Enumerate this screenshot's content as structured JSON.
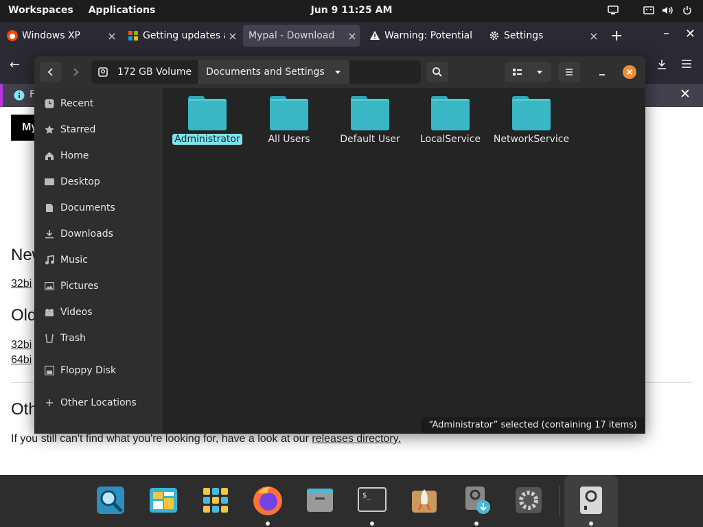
{
  "topbar": {
    "workspaces": "Workspaces",
    "applications": "Applications",
    "clock": "Jun 9  11:25 AM"
  },
  "browser": {
    "tabs": [
      {
        "title": "Windows XP",
        "favicon": "reddit-icon"
      },
      {
        "title": "Getting updates an",
        "favicon": "windows-flag-icon"
      },
      {
        "title": "Mypal - Download",
        "favicon": "none"
      },
      {
        "title": "Warning: Potential",
        "favicon": "warning-icon"
      },
      {
        "title": "Settings",
        "favicon": "gear-icon"
      }
    ],
    "active_tab_index": 2,
    "infobar_prefix": "F"
  },
  "page": {
    "logo_text": "My",
    "heading_new": "New",
    "link_32_new": "32bi",
    "heading_old": "Old",
    "link_32_old": "32bi",
    "link_64_old": "64bi",
    "heading_other": "Oth",
    "footer_text": "If you still can't find what you're looking for, have a look at our ",
    "footer_link": "releases directory."
  },
  "files": {
    "path": [
      {
        "label": "172 GB Volume",
        "icon": "drive-icon"
      },
      {
        "label": "Documents and Settings",
        "icon": "chevron-down-icon"
      }
    ],
    "sidebar": [
      {
        "label": "Recent",
        "icon": "clock-icon"
      },
      {
        "label": "Starred",
        "icon": "star-icon"
      },
      {
        "label": "Home",
        "icon": "home-icon"
      },
      {
        "label": "Desktop",
        "icon": "desktop-icon"
      },
      {
        "label": "Documents",
        "icon": "document-icon"
      },
      {
        "label": "Downloads",
        "icon": "download-icon"
      },
      {
        "label": "Music",
        "icon": "music-icon"
      },
      {
        "label": "Pictures",
        "icon": "picture-icon"
      },
      {
        "label": "Videos",
        "icon": "video-icon"
      },
      {
        "label": "Trash",
        "icon": "trash-icon"
      },
      {
        "label": "Floppy Disk",
        "icon": "floppy-icon"
      },
      {
        "label": "Other Locations",
        "icon": "plus-icon"
      }
    ],
    "folders": [
      {
        "name": "Administrator",
        "selected": true
      },
      {
        "name": "All Users",
        "selected": false
      },
      {
        "name": "Default User",
        "selected": false
      },
      {
        "name": "LocalService",
        "selected": false
      },
      {
        "name": "NetworkService",
        "selected": false
      }
    ],
    "status": "“Administrator” selected  (containing 17 items)",
    "accent_color": "#3ab7c4",
    "close_button_color": "#f08c3a"
  },
  "dock": [
    {
      "name": "search-app",
      "running": false
    },
    {
      "name": "multitasking-app",
      "running": false
    },
    {
      "name": "app-grid",
      "running": false
    },
    {
      "name": "firefox-app",
      "running": true
    },
    {
      "name": "files-app",
      "running": false
    },
    {
      "name": "terminal-app",
      "running": true
    },
    {
      "name": "launcher-app",
      "running": false
    },
    {
      "name": "installer-app",
      "running": true
    },
    {
      "name": "settings-app",
      "running": false
    },
    {
      "name": "disk-app",
      "running": true
    }
  ]
}
